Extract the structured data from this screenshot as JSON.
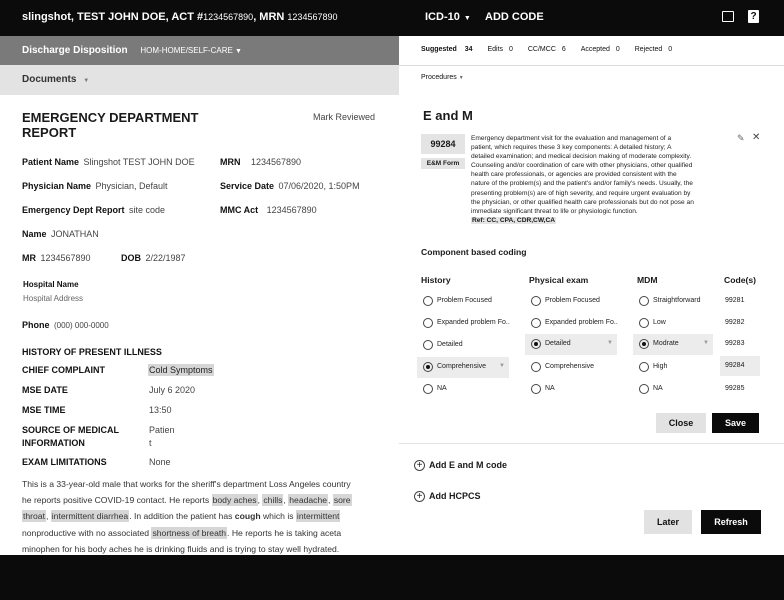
{
  "topbar": {
    "patient_name": "slingshot, TEST JOHN DOE",
    "act_label": ", ACT #",
    "act_value": "1234567890",
    "mrn_label": ", MRN",
    "mrn_value": "1234567890",
    "icd_label": "ICD-10",
    "add_code": "ADD CODE"
  },
  "discharge": {
    "label": "Discharge Disposition",
    "value": "HOM-HOME/SELF-CARE"
  },
  "documents": {
    "label": "Documents"
  },
  "report": {
    "title_line1": "EMERGENCY DEPARTMENT",
    "title_line2": "REPORT",
    "mark_reviewed": "Mark Reviewed",
    "patient_name_label": "Patient Name",
    "patient_name_value": "Slingshot TEST JOHN DOE",
    "mrn_label": "MRN",
    "mrn_value": "1234567890",
    "physician_label": "Physician Name",
    "physician_value": "Physician, Default",
    "service_date_label": "Service Date",
    "service_date_value": "07/06/2020, 1:50PM",
    "ed_report_label": "Emergency Dept Report",
    "ed_report_value": "site code",
    "mmc_act_label": "MMC Act",
    "mmc_act_value": "1234567890",
    "name_label": "Name",
    "name_value": "JONATHAN",
    "mr_label": "MR",
    "mr_value": "1234567890",
    "dob_label": "DOB",
    "dob_value": "2/22/1987",
    "hospital_name_label": "Hospital Name",
    "hospital_address": "Hospital Address",
    "phone_label": "Phone",
    "phone_value": "(000) 000-0000",
    "hpi_heading": "HISTORY OF PRESENT ILLNESS",
    "chief_complaint_label": "CHIEF COMPLAINT",
    "chief_complaint_value": "Cold Symptoms",
    "mse_date_label": "MSE DATE",
    "mse_date_value": "July 6 2020",
    "mse_time_label": "MSE TIME",
    "mse_time_value": "13:50",
    "source_label_1": "SOURCE OF MEDICAL",
    "source_label_2": "INFORMATION",
    "source_value_1": "Patien",
    "source_value_2": "t",
    "exam_limit_label": "EXAM LIMITATIONS",
    "exam_limit_value": "None",
    "narrative": {
      "l1": "This is a 33-year-old male that works for the sheriff's department Loss Angeles country",
      "l2a": "he reports positive COVID-19 contact. He reports ",
      "l2_body_aches": "body aches",
      "l2_c1": ", ",
      "l2_chills": "chills",
      "l2_c2": ", ",
      "l2_headache": "headache",
      "l2_c3": ", ",
      "l2_sore": "sore",
      "l3_throat": "throat",
      "l3_c1": ", ",
      "l3_diarrhea": "intermittent diarrhea",
      "l3_mid": ". In addition the patient has ",
      "l3_cough": "cough",
      "l3_which": " which is ",
      "l3_intermittent": "intermittent",
      "l4a": "nonproductive with no associated ",
      "l4_sob": "shortness of breath",
      "l4b": ". He reports he is taking aceta",
      "l5": "minophen for his body aches he is drinking fluids and is trying to stay well hydrated."
    }
  },
  "tabs": {
    "suggested_label": "Suggested",
    "suggested_count": "34",
    "edits_label": "Edits",
    "edits_count": "0",
    "ccmcc_label": "CC/MCC",
    "ccmcc_count": "6",
    "accepted_label": "Accepted",
    "accepted_count": "0",
    "rejected_label": "Rejected",
    "rejected_count": "0"
  },
  "procedures": {
    "label": "Procedures"
  },
  "em": {
    "heading": "E and M",
    "code": "99284",
    "form_label": "E&M Form",
    "description": [
      "Emergency department visit for the evaluation and management of a",
      "patient, which requires these 3 key components: A detailed history; A",
      "detailed examination; and medical decision making of moderate complexity.",
      "Counseling and/or coordination of care with other physicians, other qualified",
      "health care professionals, or agencies are provided consistent with the",
      "nature of the problem(s) and the patient's and/or family's needs. Usually, the",
      "presenting problem(s) are of high severity, and require urgent evaluation by",
      "the physician, or other qualified health care professionals but do not pose an",
      "immediate significant threat to life or physiologic function."
    ],
    "ref": "Ref: CC, CPA, CDR,CW,CA",
    "component_heading": "Component based coding",
    "col_history": "History",
    "col_exam": "Physical exam",
    "col_mdm": "MDM",
    "col_codes": "Code(s)",
    "history": [
      "Problem Focused",
      "Expanded problem Fo..",
      "Detailed",
      "Comprehensive",
      "NA"
    ],
    "exam": [
      "Problem Focused",
      "Expanded problem Fo..",
      "Detailed",
      "Comprehensive",
      "NA"
    ],
    "mdm": [
      "Straightforward",
      "Low",
      "Modrate",
      "High",
      "NA"
    ],
    "codes": [
      "99281",
      "99282",
      "99283",
      "99284",
      "99285"
    ],
    "close": "Close",
    "save": "Save",
    "add_em": "Add E and M code",
    "add_hcpcs": "Add HCPCS",
    "later": "Later",
    "refresh": "Refresh"
  }
}
